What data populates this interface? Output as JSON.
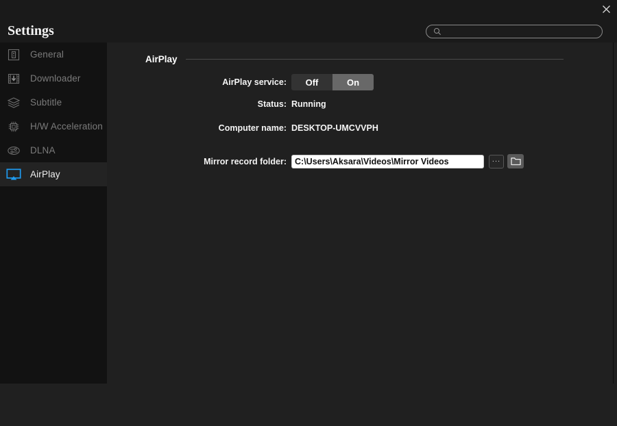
{
  "window": {
    "title": "Settings",
    "close_icon": "close-icon"
  },
  "search": {
    "icon": "search-icon",
    "value": "",
    "placeholder": ""
  },
  "sidebar": {
    "items": [
      {
        "label": "General",
        "icon": "general-icon",
        "active": false
      },
      {
        "label": "Downloader",
        "icon": "downloader-icon",
        "active": false
      },
      {
        "label": "Subtitle",
        "icon": "subtitle-icon",
        "active": false
      },
      {
        "label": "H/W Acceleration",
        "icon": "hw-chip-icon",
        "active": false
      },
      {
        "label": "DLNA",
        "icon": "dlna-icon",
        "active": false
      },
      {
        "label": "AirPlay",
        "icon": "airplay-icon",
        "active": true
      }
    ]
  },
  "main": {
    "section_title": "AirPlay",
    "rows": {
      "service": {
        "label": "AirPlay service:",
        "options": [
          "Off",
          "On"
        ],
        "selected": "On"
      },
      "status": {
        "label": "Status:",
        "value": "Running"
      },
      "computer_name": {
        "label": "Computer name:",
        "value": "DESKTOP-UMCVVPH"
      },
      "mirror_folder": {
        "label": "Mirror record folder:",
        "value": "C:\\Users\\Aksara\\Videos\\Mirror Videos",
        "placeholder": "",
        "browse_label": "...",
        "open_folder_icon": "folder-icon"
      }
    }
  },
  "colors": {
    "accent": "#1e9bf0",
    "window_bg": "#202020",
    "sidebar_bg": "#121212",
    "topbar_bg": "#1a1a1a",
    "active_row_bg": "#232323"
  }
}
